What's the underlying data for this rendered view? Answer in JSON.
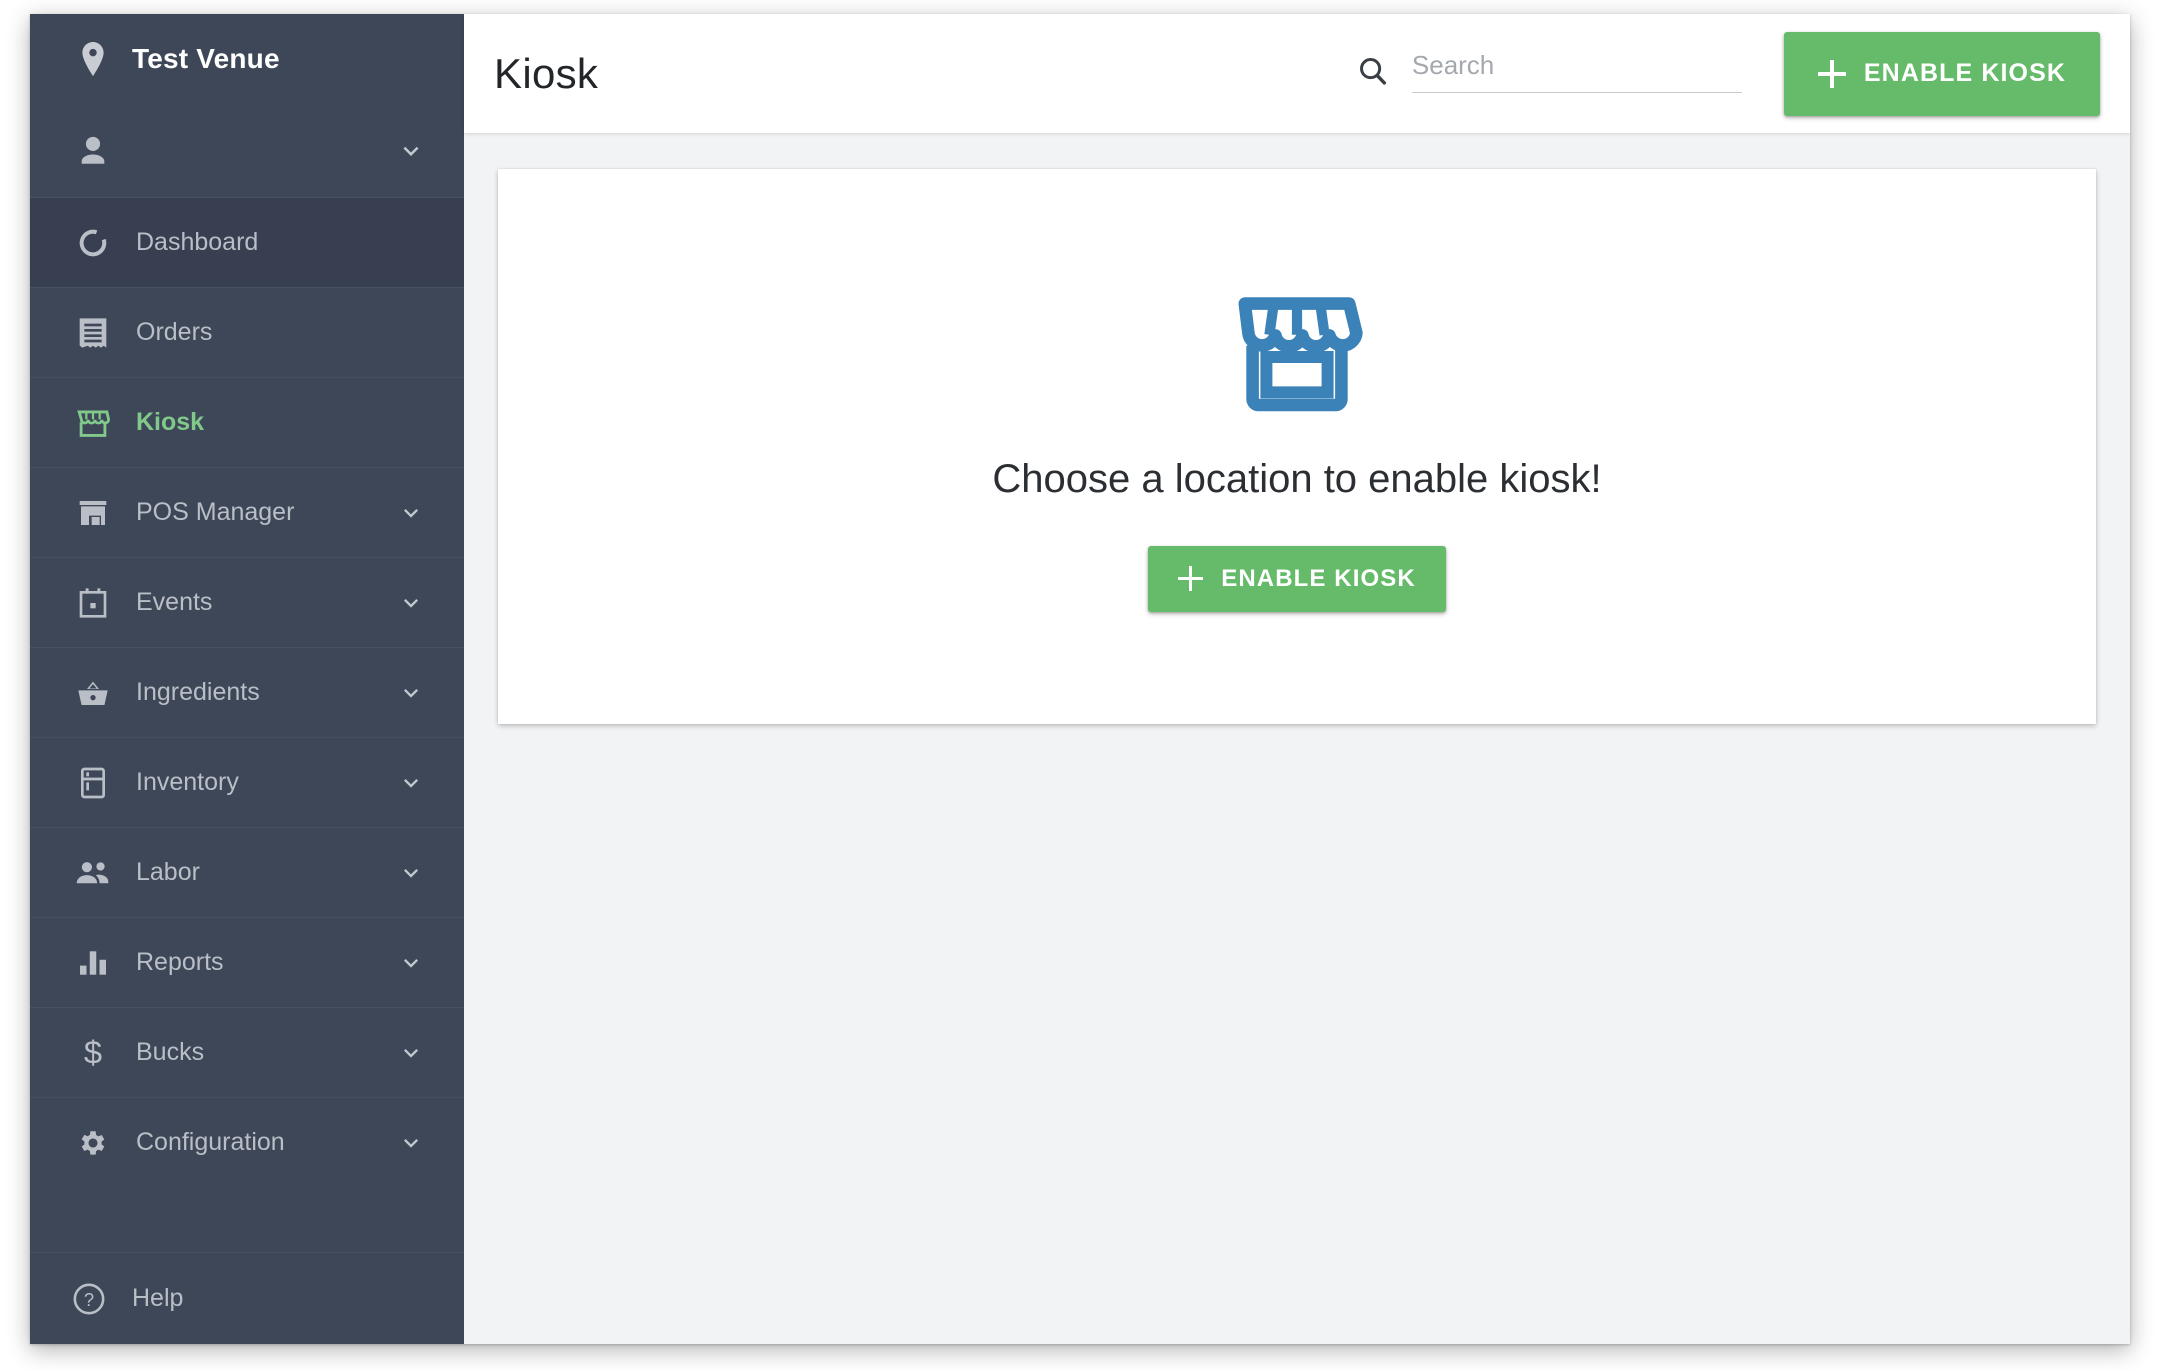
{
  "sidebar": {
    "venue": {
      "name": "Test Venue",
      "icon": "location-pin-icon"
    },
    "user": {
      "icon": "person-icon",
      "chevron": "chevron-down-icon"
    },
    "items": [
      {
        "label": "Dashboard",
        "icon": "dashboard-ring-icon",
        "expandable": false,
        "active": false,
        "shaded": true
      },
      {
        "label": "Orders",
        "icon": "receipt-icon",
        "expandable": false,
        "active": false,
        "shaded": false
      },
      {
        "label": "Kiosk",
        "icon": "storefront-awning-icon",
        "expandable": false,
        "active": true,
        "shaded": false
      },
      {
        "label": "POS Manager",
        "icon": "storefront-icon",
        "expandable": true,
        "active": false,
        "shaded": false
      },
      {
        "label": "Events",
        "icon": "calendar-icon",
        "expandable": true,
        "active": false,
        "shaded": false
      },
      {
        "label": "Ingredients",
        "icon": "basket-icon",
        "expandable": true,
        "active": false,
        "shaded": false
      },
      {
        "label": "Inventory",
        "icon": "refrigerator-icon",
        "expandable": true,
        "active": false,
        "shaded": false
      },
      {
        "label": "Labor",
        "icon": "people-icon",
        "expandable": true,
        "active": false,
        "shaded": false
      },
      {
        "label": "Reports",
        "icon": "bar-chart-icon",
        "expandable": true,
        "active": false,
        "shaded": false
      },
      {
        "label": "Bucks",
        "icon": "dollar-sign-icon",
        "expandable": true,
        "active": false,
        "shaded": false
      },
      {
        "label": "Configuration",
        "icon": "gear-icon",
        "expandable": true,
        "active": false,
        "shaded": false
      }
    ],
    "help": {
      "label": "Help",
      "icon": "help-circle-icon"
    }
  },
  "header": {
    "title": "Kiosk",
    "search": {
      "placeholder": "Search",
      "value": "",
      "icon": "search-icon"
    },
    "enable_kiosk_label": "ENABLE KIOSK"
  },
  "main": {
    "empty_state": {
      "icon": "store-icon",
      "message": "Choose a location to enable kiosk!",
      "enable_kiosk_label": "ENABLE KIOSK"
    }
  },
  "colors": {
    "sidebar_bg": "#3d4757",
    "sidebar_shaded": "#373f50",
    "accent_green": "#66bb6a",
    "active_green": "#81c98b",
    "store_blue": "#3b82b8",
    "page_bg": "#f1f3f5",
    "sidebar_text": "#b9bec7"
  }
}
